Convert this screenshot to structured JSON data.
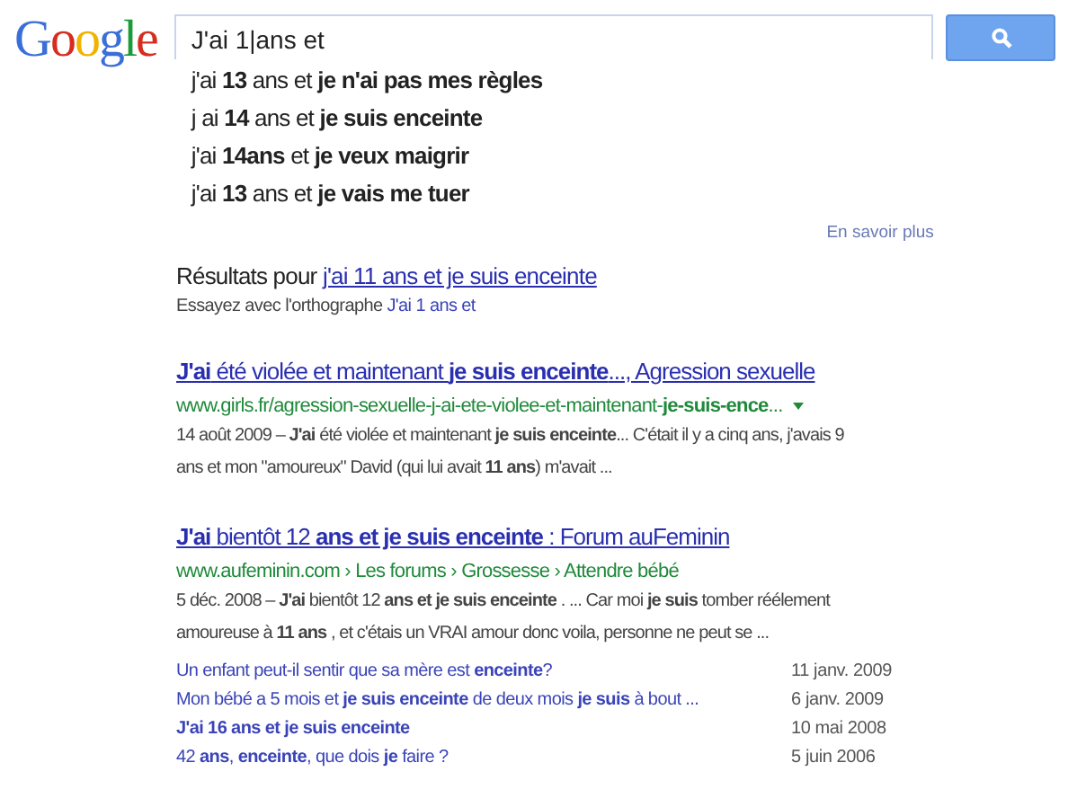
{
  "logo": "Google",
  "search": {
    "value": "J'ai 1|ans et"
  },
  "suggestions": [
    "j'ai **13** ans et **je n'ai pas mes règles**",
    "j ai **14** ans et **je suis enceinte**",
    "j'ai **14ans** et **je veux maigrir**",
    "j'ai **13** ans et **je vais me tuer**"
  ],
  "learn_more": "En savoir plus",
  "results_for": {
    "label": "Résultats pour",
    "query": "j'ai 11 ans et je suis enceinte"
  },
  "spelling": {
    "label": "Essayez avec l'orthographe",
    "query": "J'ai 1 ans et"
  },
  "results": [
    {
      "title": "**J'ai** été violée et maintenant **je suis enceinte**..., Agression sexuelle",
      "url": "www.girls.fr/agression-sexuelle-j-ai-ete-violee-et-maintenant-**je-suis-ence**...",
      "snippet": "14 août 2009 – **J'ai** été violée et maintenant **je suis enceinte**... C'était il y a cinq ans, j'avais 9 ans et mon \"amoureux\" David (qui lui avait **11 ans**) m'avait ..."
    },
    {
      "title": "**J'ai** bientôt 12 **ans et je suis enceinte** : Forum auFeminin",
      "url": "www.aufeminin.com › Les forums › Grossesse › Attendre bébé",
      "snippet": "5 déc. 2008 – **J'ai** bientôt 12 **ans et je suis enceinte** . ... Car moi **je suis** tomber réélement amoureuse à **11 ans** , et c'étais un VRAI amour donc voila, personne ne peut se ...",
      "sublinks": [
        {
          "text": "Un enfant peut-il sentir que sa mère est **enceinte**?",
          "date": "11 janv. 2009"
        },
        {
          "text": "Mon bébé a 5 mois et **je suis enceinte** de deux mois **je suis** à bout ...",
          "date": "6 janv. 2009"
        },
        {
          "text": "**J'ai 16 ans et je suis enceinte**",
          "date": "10 mai 2008"
        },
        {
          "text": "42 **ans**, **enceinte**, que dois **je** faire ?",
          "date": "5 juin 2006"
        }
      ]
    }
  ]
}
